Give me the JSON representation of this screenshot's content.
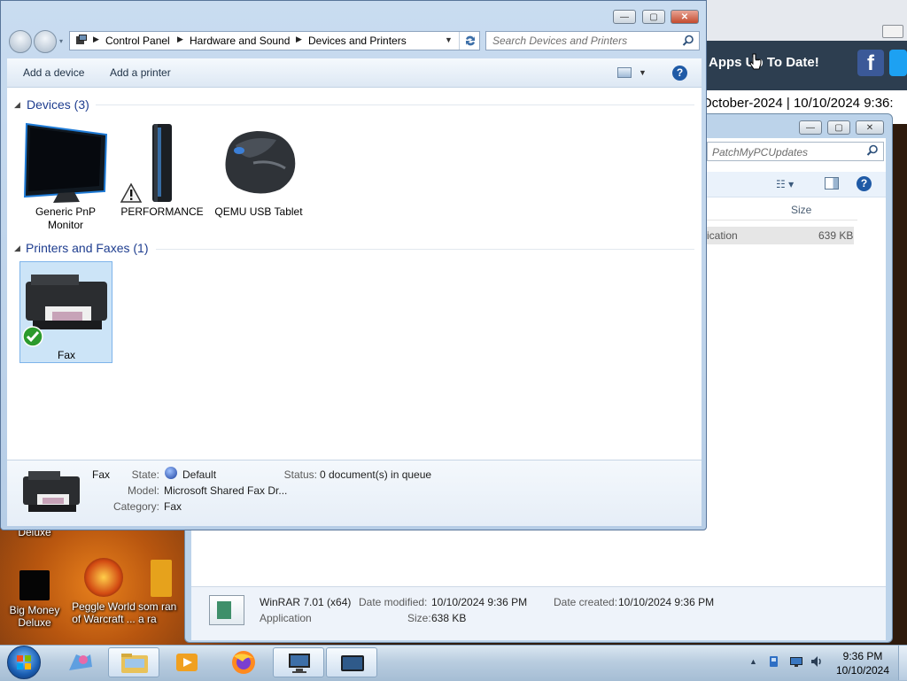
{
  "desktop": {
    "icons": [
      {
        "label": "Big Money Deluxe"
      },
      {
        "label": "Peggle World of Warcraft ..."
      },
      {
        "label": "som ran a ra"
      },
      {
        "label": "Deluxe"
      }
    ]
  },
  "browser_bg": {
    "banner_text": "Apps Up To Date!",
    "date_text": "October-2024 | 10/10/2024 9:36:",
    "facebook_glyph": "f"
  },
  "explorer_bg": {
    "search_placeholder": "PatchMyPCUpdates",
    "column_size": "Size",
    "row_type": "ication",
    "row_size": "639 KB",
    "details": {
      "name": "WinRAR 7.01 (x64)",
      "type": "Application",
      "date_modified_label": "Date modified:",
      "date_modified": "10/10/2024 9:36 PM",
      "date_created_label": "Date created:",
      "date_created": "10/10/2024 9:36 PM",
      "size_label": "Size:",
      "size": "638 KB"
    }
  },
  "window": {
    "controls": {
      "minimize": "—",
      "maximize": "▢",
      "close": "✕"
    },
    "breadcrumbs": [
      "Control Panel",
      "Hardware and Sound",
      "Devices and Printers"
    ],
    "search_placeholder": "Search Devices and Printers",
    "toolbar": {
      "add_device": "Add a device",
      "add_printer": "Add a printer",
      "help": "?"
    },
    "groups": {
      "devices": {
        "title": "Devices (3)",
        "items": [
          {
            "label": "Generic PnP Monitor"
          },
          {
            "label": "PERFORMANCE"
          },
          {
            "label": "QEMU USB Tablet"
          }
        ]
      },
      "printers": {
        "title": "Printers and Faxes (1)",
        "items": [
          {
            "label": "Fax"
          }
        ]
      }
    },
    "details": {
      "name": "Fax",
      "state_label": "State:",
      "state": "Default",
      "status_label": "Status:",
      "status": "0 document(s) in queue",
      "model_label": "Model:",
      "model": "Microsoft Shared Fax Dr...",
      "category_label": "Category:",
      "category": "Fax"
    }
  },
  "taskbar": {
    "time": "9:36 PM",
    "date": "10/10/2024"
  },
  "colors": {
    "group_title": "#1e3d8f",
    "selection": "#cce4f7",
    "taskbar": "#b9cde0"
  }
}
